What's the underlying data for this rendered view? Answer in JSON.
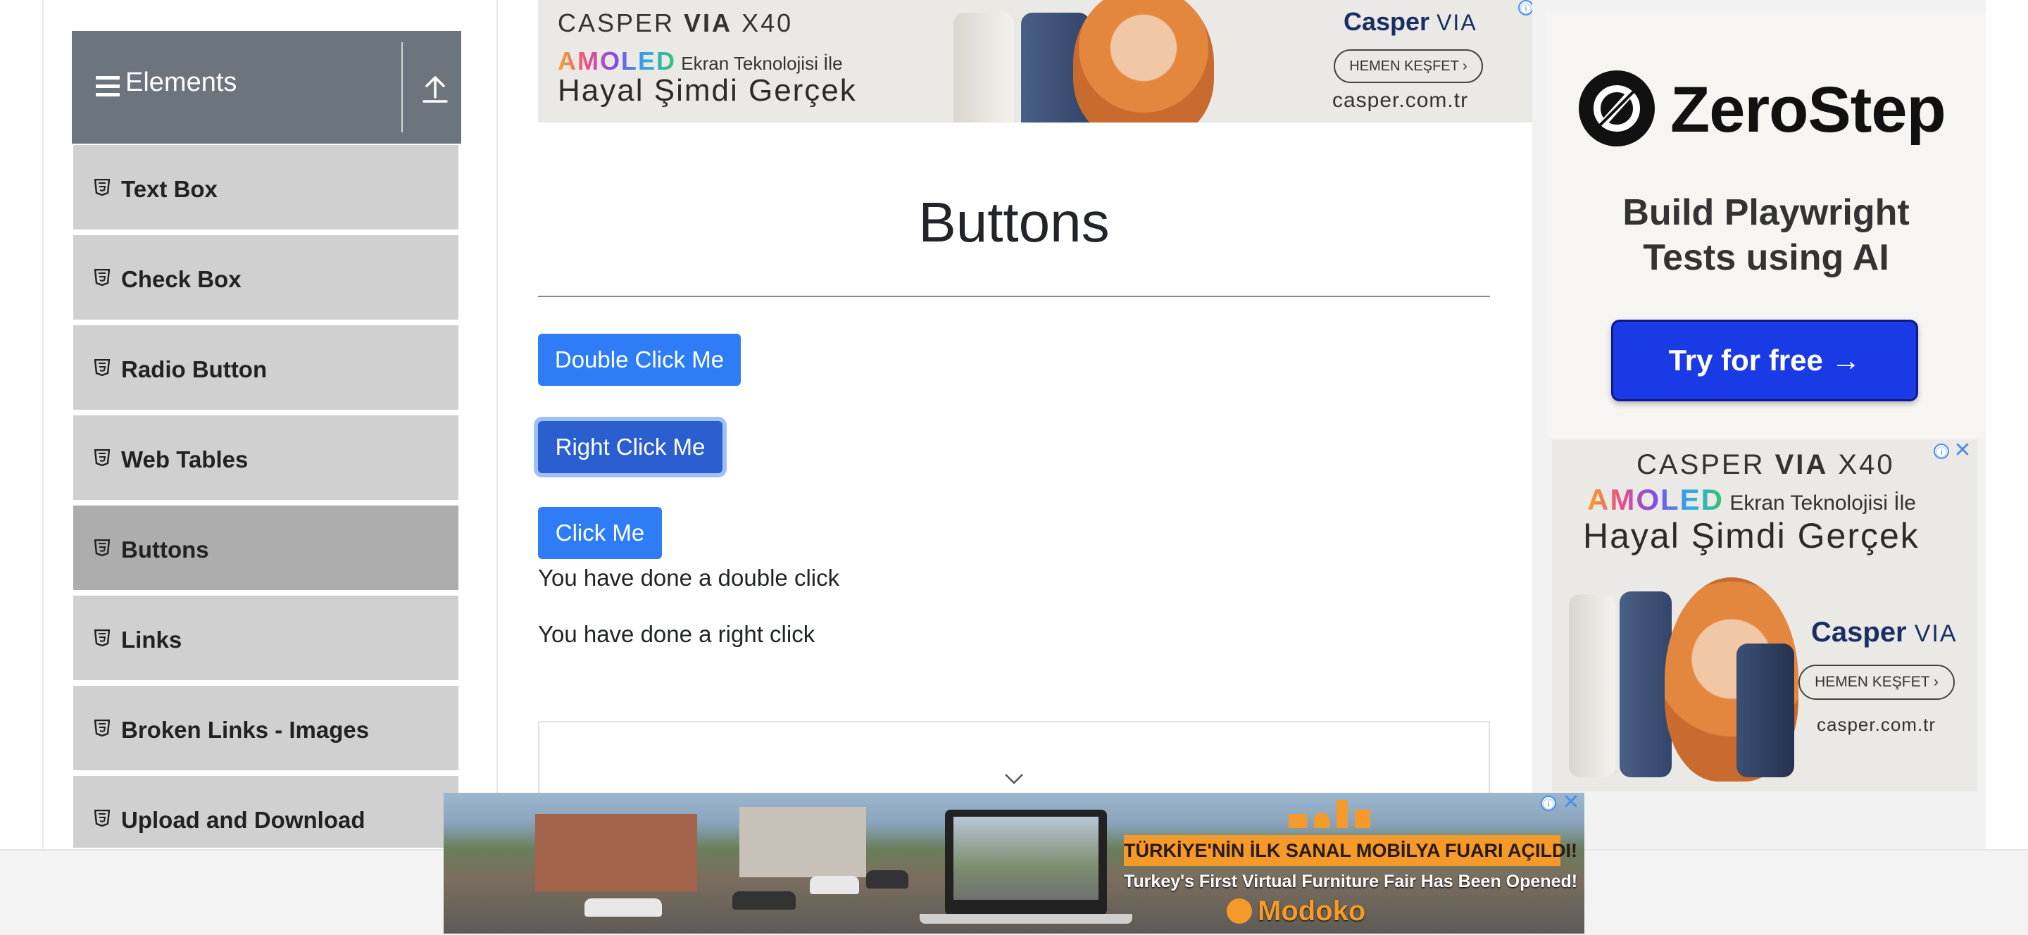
{
  "sidebar": {
    "group_title": "Elements",
    "items": [
      {
        "label": "Text Box"
      },
      {
        "label": "Check Box"
      },
      {
        "label": "Radio Button"
      },
      {
        "label": "Web Tables"
      },
      {
        "label": "Buttons",
        "active": true
      },
      {
        "label": "Links"
      },
      {
        "label": "Broken Links - Images"
      },
      {
        "label": "Upload and Download"
      }
    ]
  },
  "main": {
    "title": "Buttons",
    "buttons": {
      "double_click": "Double Click Me",
      "right_click": "Right Click Me",
      "click": "Click Me"
    },
    "messages": {
      "double": "You have done a double click",
      "right": "You have done a right click"
    }
  },
  "ads": {
    "casper_top": {
      "model_prefix": "CASPER ",
      "model_bold": "VIA",
      "model_suffix": " X40",
      "amoled": "AMOLED",
      "tech_line": "Ekran Teknolojisi İle",
      "slogan": "Hayal Şimdi Gerçek",
      "brand": "Casper",
      "brand_suffix": "VIA",
      "cta": "HEMEN KEŞFET",
      "url": "casper.com.tr"
    },
    "zerostep": {
      "name": "ZeroStep",
      "tagline_1": "Build Playwright",
      "tagline_2": "Tests using AI",
      "cta": "Try for free →"
    },
    "casper_side": {
      "model_prefix": "CASPER ",
      "model_bold": "VIA",
      "model_suffix": " X40",
      "amoled": "AMOLED",
      "tech_line": "Ekran Teknolojisi İle",
      "slogan": "Hayal Şimdi Gerçek",
      "brand": "Casper",
      "brand_suffix": "VIA",
      "cta": "HEMEN KEŞFET",
      "url": "casper.com.tr"
    },
    "modoko": {
      "headline": "TÜRKİYE'NİN İLK SANAL MOBİLYA FUARI AÇILDI!",
      "subline": "Turkey's First Virtual Furniture Fair Has Been Opened!",
      "brand": "Modoko"
    },
    "info_glyph": "ⓘ",
    "close_glyph": "✕"
  },
  "colors": {
    "primary_button": "#2f7df6",
    "focused_button": "#2b5fd0",
    "sidebar_header": "#6c757d",
    "sidebar_item": "#d0d0d0",
    "sidebar_item_active": "#adadad"
  }
}
